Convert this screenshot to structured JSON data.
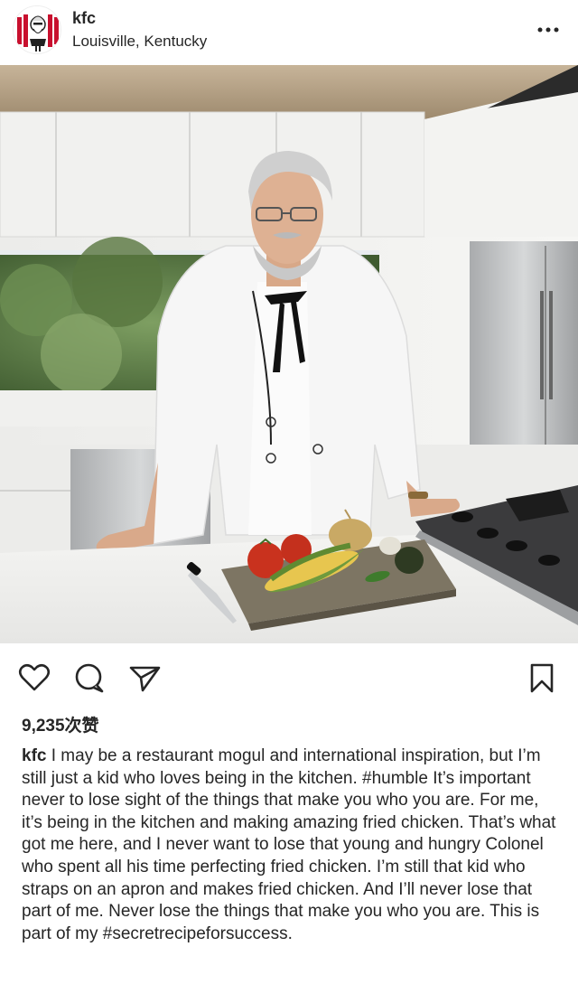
{
  "post": {
    "username": "kfc",
    "location": "Louisville, Kentucky",
    "more_label": "•••"
  },
  "icons": {
    "avatar": "colonel-logo",
    "more": "more-horizontal-icon",
    "like": "heart-icon",
    "comment": "comment-icon",
    "share": "send-icon",
    "save": "bookmark-icon"
  },
  "likes": "9,235次赞",
  "caption": {
    "username": "kfc",
    "text": " I may be a restaurant mogul and international inspiration, but I’m still just a kid who loves being in the kitchen. #humble It’s important never to lose sight of the things that make you who you are. For me, it’s being in the kitchen and making amazing fried chicken. That’s what got me here, and I never want to lose that young and hungry Colonel who spent all his time perfecting fried chicken. I’m still that kid who straps on an apron and makes fried chicken. And I’ll never lose that part of me. Never lose the things that make you who you are. This is part of my #secretrecipeforsuccess."
  },
  "colors": {
    "brand_red": "#c8102e",
    "text": "#262626"
  }
}
